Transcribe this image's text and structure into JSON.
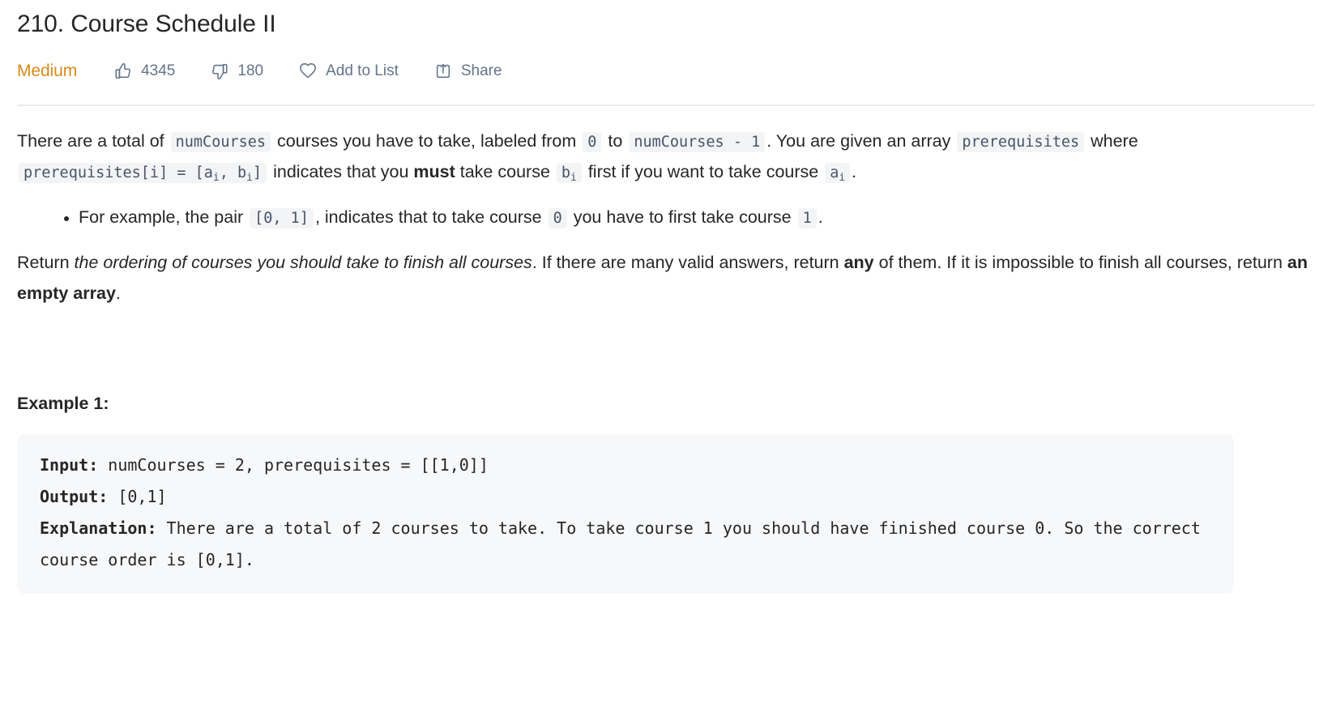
{
  "problem": {
    "title": "210. Course Schedule II",
    "difficulty": "Medium"
  },
  "actions": {
    "likes": "4345",
    "dislikes": "180",
    "add_to_list": "Add to List",
    "share": "Share",
    "icons": {
      "like": "thumbs-up-icon",
      "dislike": "thumbs-down-icon",
      "favorite": "heart-icon",
      "share": "share-icon"
    }
  },
  "description": {
    "p1": {
      "t1": "There are a total of ",
      "c1": "numCourses",
      "t2": " courses you have to take, labeled from ",
      "c2": "0",
      "t3": " to ",
      "c3": "numCourses - 1",
      "t4": ". You are given an array ",
      "c4": "prerequisites",
      "t5": " where ",
      "c5": "prerequisites[i] = [a",
      "c5sub": "i",
      "c5b": ", b",
      "c5sub2": "i",
      "c5c": "]",
      "t6": " indicates that you ",
      "b1": "must",
      "t7": " take course ",
      "c6": "b",
      "c6sub": "i",
      "t8": " first if you want to take course ",
      "c7": "a",
      "c7sub": "i",
      "t9": "."
    },
    "bullet": {
      "t1": "For example, the pair ",
      "c1": "[0, 1]",
      "t2": ", indicates that to take course ",
      "c2": "0",
      "t3": " you have to first take course ",
      "c3": "1",
      "t4": "."
    },
    "p2": {
      "t1": "Return ",
      "i1": "the ordering of courses you should take to finish all courses",
      "t2": ". If there are many valid answers, return ",
      "b1": "any",
      "t3": " of them. If it is impossible to finish all courses, return ",
      "b2": "an empty array",
      "t4": "."
    }
  },
  "example": {
    "heading": "Example 1:",
    "input_label": "Input:",
    "input_value": " numCourses = 2, prerequisites = [[1,0]]",
    "output_label": "Output:",
    "output_value": " [0,1]",
    "explanation_label": "Explanation:",
    "explanation_value": " There are a total of 2 courses to take. To take course 1 you should have finished course 0. So the correct course order is [0,1]."
  },
  "colors": {
    "difficulty_orange": "#d98b18",
    "code_bg": "#f3f4f6",
    "code_text": "#475569",
    "example_bg": "#f7f8fa",
    "muted": "#64748b"
  }
}
